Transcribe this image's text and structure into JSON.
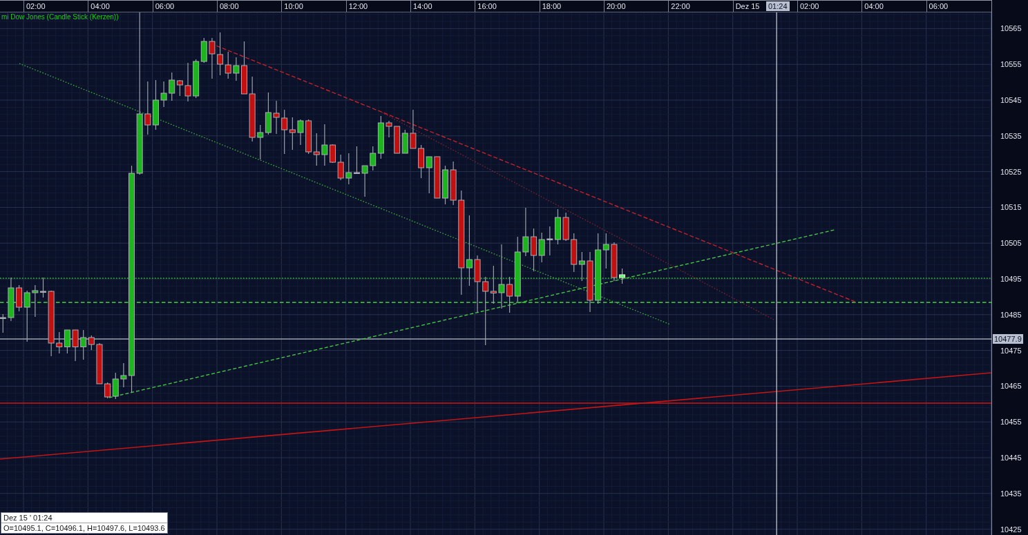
{
  "chart": {
    "title": "mi Dow Jones (Candle Stick (Kerzen))"
  },
  "time_axis": {
    "labels": [
      "02:00",
      "04:00",
      "06:00",
      "08:00",
      "10:00",
      "12:00",
      "14:00",
      "16:00",
      "18:00",
      "20:00",
      "22:00",
      "Dez 15",
      "02:00",
      "04:00",
      "06:00"
    ],
    "cursor_label": "01:24"
  },
  "price_axis": {
    "labels": [
      "10565",
      "10555",
      "10545",
      "10535",
      "10525",
      "10515",
      "10505",
      "10495",
      "10485",
      "10475",
      "10465",
      "10455",
      "10445",
      "10435",
      "10425"
    ],
    "last_price": "10477.9"
  },
  "info_box": {
    "date": "Dez 15 ' 01:24",
    "ohlc": "O=10495.1, C=10496.1, H=10497.6, L=10493.6"
  }
}
